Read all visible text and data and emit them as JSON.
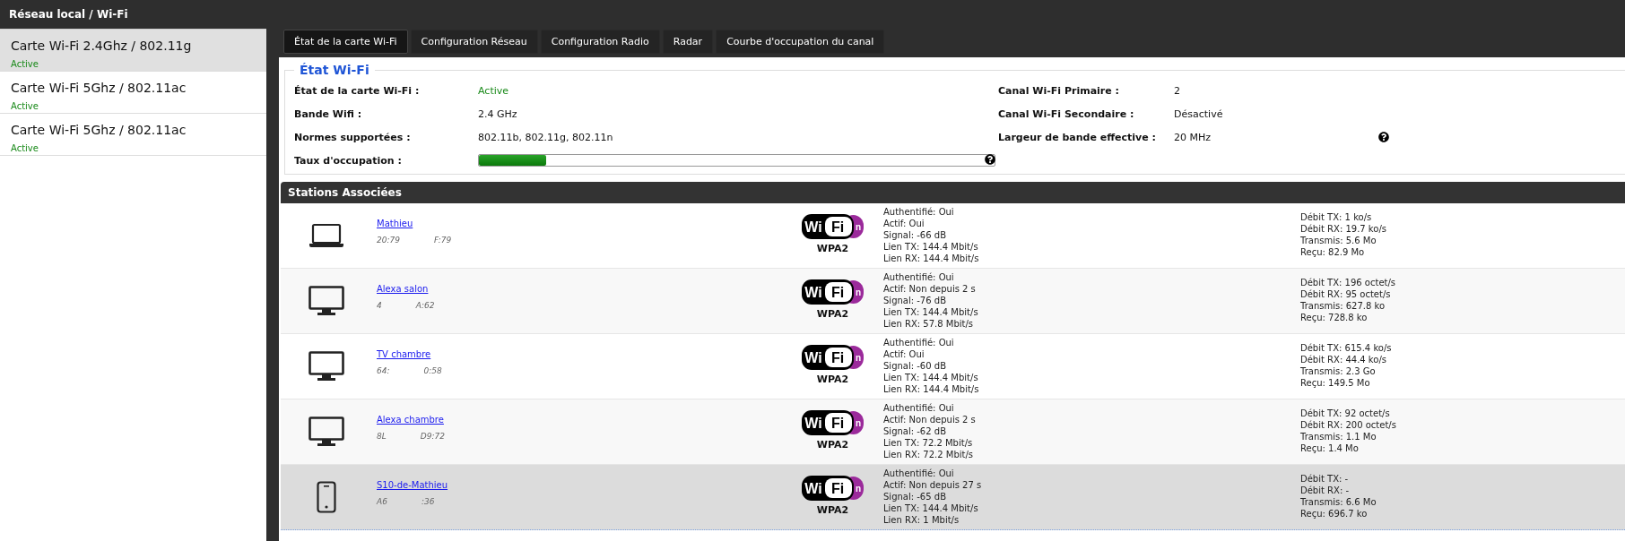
{
  "window": {
    "title": "Réseau local / Wi-Fi"
  },
  "sidebar": {
    "items": [
      {
        "label": "Carte Wi-Fi 2.4Ghz / 802.11g",
        "status": "Active",
        "selected": true
      },
      {
        "label": "Carte Wi-Fi 5Ghz / 802.11ac",
        "status": "Active",
        "selected": false
      },
      {
        "label": "Carte Wi-Fi 5Ghz / 802.11ac",
        "status": "Active",
        "selected": false
      }
    ]
  },
  "tabs": [
    {
      "label": "État de la carte Wi-Fi",
      "selected": true
    },
    {
      "label": "Configuration Réseau",
      "selected": false
    },
    {
      "label": "Configuration Radio",
      "selected": false
    },
    {
      "label": "Radar",
      "selected": false
    },
    {
      "label": "Courbe d'occupation du canal",
      "selected": false
    }
  ],
  "wifi_state": {
    "title": "État Wi-Fi",
    "left": [
      {
        "label": "État de la carte Wi-Fi :",
        "value": "Active",
        "kind": "status"
      },
      {
        "label": "Bande Wifi :",
        "value": "2.4 GHz",
        "kind": "text"
      },
      {
        "label": "Normes supportées :",
        "value": "802.11b, 802.11g, 802.11n",
        "kind": "text"
      },
      {
        "label": "Taux d'occupation :",
        "kind": "meter",
        "level": 0.13
      }
    ],
    "right": [
      {
        "label": "Canal Wi-Fi Primaire :",
        "value": "2",
        "help": false
      },
      {
        "label": "Canal Wi-Fi Secondaire :",
        "value": "Désactivé",
        "help": false
      },
      {
        "label": "Largeur de bande effective :",
        "value": "20 MHz",
        "help": true
      }
    ]
  },
  "stations": {
    "title": "Stations Associées",
    "rows": [
      {
        "kind": "laptop",
        "name": "Mathieu",
        "mac_start": "20:79",
        "mac_end": "F:79",
        "logo": [
          "Wi",
          "Fi",
          "n"
        ],
        "security": "WPA2",
        "details": [
          "Authentifié: Oui",
          "Actif: Oui",
          "Signal: -66 dB",
          "Lien TX: 144.4 Mbit/s",
          "Lien RX: 144.4 Mbit/s"
        ],
        "traffic": [
          "Débit TX: 1 ko/s",
          "Débit RX: 19.7 ko/s",
          "Transmis: 5.6 Mo",
          "Reçu: 82.9 Mo"
        ],
        "selected": false
      },
      {
        "kind": "monitor",
        "name": "Alexa salon",
        "mac_start": "4",
        "mac_end": "A:62",
        "logo": [
          "Wi",
          "Fi",
          "n"
        ],
        "security": "WPA2",
        "details": [
          "Authentifié: Oui",
          "Actif: Non depuis 2 s",
          "Signal: -76 dB",
          "Lien TX: 144.4 Mbit/s",
          "Lien RX: 57.8 Mbit/s"
        ],
        "traffic": [
          "Débit TX: 196 octet/s",
          "Débit RX: 95 octet/s",
          "Transmis: 627.8 ko",
          "Reçu: 728.8 ko"
        ],
        "selected": false
      },
      {
        "kind": "monitor",
        "name": "TV chambre",
        "mac_start": "64:",
        "mac_end": "0:58",
        "logo": [
          "Wi",
          "Fi",
          "n"
        ],
        "security": "WPA2",
        "details": [
          "Authentifié: Oui",
          "Actif: Oui",
          "Signal: -60 dB",
          "Lien TX: 144.4 Mbit/s",
          "Lien RX: 144.4 Mbit/s"
        ],
        "traffic": [
          "Débit TX: 615.4 ko/s",
          "Débit RX: 44.4 ko/s",
          "Transmis: 2.3 Go",
          "Reçu: 149.5 Mo"
        ],
        "selected": false
      },
      {
        "kind": "monitor",
        "name": "Alexa chambre",
        "mac_start": "8L",
        "mac_end": "D9:72",
        "logo": [
          "Wi",
          "Fi",
          "n"
        ],
        "security": "WPA2",
        "details": [
          "Authentifié: Oui",
          "Actif: Non depuis 2 s",
          "Signal: -62 dB",
          "Lien TX: 72.2 Mbit/s",
          "Lien RX: 72.2 Mbit/s"
        ],
        "traffic": [
          "Débit TX: 92 octet/s",
          "Débit RX: 200 octet/s",
          "Transmis: 1.1 Mo",
          "Reçu: 1.4 Mo"
        ],
        "selected": false
      },
      {
        "kind": "phone",
        "name": "S10-de-Mathieu",
        "mac_start": "A6",
        "mac_end": ":36",
        "logo": [
          "Wi",
          "Fi",
          "n"
        ],
        "security": "WPA2",
        "details": [
          "Authentifié: Oui",
          "Actif: Non depuis 27 s",
          "Signal: -65 dB",
          "Lien TX: 144.4 Mbit/s",
          "Lien RX: 1 Mbit/s"
        ],
        "traffic": [
          "Débit TX: -",
          "Débit RX: -",
          "Transmis: 6.6 Mo",
          "Reçu: 696.7 ko"
        ],
        "selected": true
      }
    ]
  }
}
